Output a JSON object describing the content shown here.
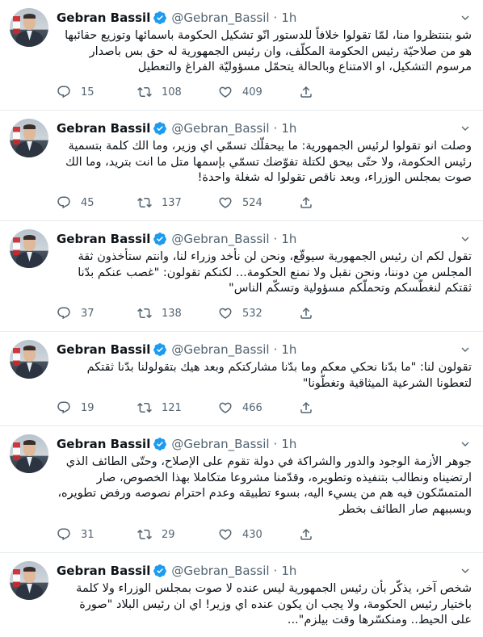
{
  "profile": {
    "name": "Gebran Bassil",
    "handle": "@Gebran_Bassil",
    "separator": "·",
    "time": "1h"
  },
  "tweets": [
    {
      "text": "شو بتنتظروا منا، لمّا تقولوا خلافاً للدستور انّو تشكيل الحكومة باسمائها وتوزيع حقائبها هو من صلاحيّة رئيس الحكومة المكلّف، وان رئيس الجمهورية له حق بس باصدار مرسوم التشكيل، او الامتناع وبالحالة يتحمّل مسؤوليّة الفراغ والتعطيل",
      "replies": "15",
      "retweets": "108",
      "likes": "409"
    },
    {
      "text": "وصلت انو تقولوا لرئيس الجمهورية: ما بيحقلّك تسمّي اي وزير، وما الك كلمة بتسمية رئيس الحكومة، ولا حتّى  بيحق لكتلة تفوّضك تسمّي بإسمها متل ما انت بتريد، وما الك صوت بمجلس الوزراء، وبعد ناقص تقولوا له شغلة واحدة!",
      "replies": "45",
      "retweets": "137",
      "likes": "524"
    },
    {
      "text": "تقول لكم ان رئيس الجمهورية سيوقّع، ونحن لن نأخد وزراء لنا، وانتم ستأخذون ثقة المجلس من دوننا، ونحن نقبل ولا  نمنع الحكومة... لكنكم تقولون: \"غصب عنكم بدّنا ثقتكم لنغطّسكم وتحملّكم مسؤولية وتسكّم الناس\"",
      "replies": "37",
      "retweets": "138",
      "likes": "532"
    },
    {
      "text": "تقولون لنا: \"ما بدّنا نحكي معكم وما بدّنا مشاركتكم وبعد هيك بتقولولنا بدّنا ثقتكم لتعطونا الشرعية الميثاقية وتغطّونا\"",
      "replies": "19",
      "retweets": "121",
      "likes": "466"
    },
    {
      "text": "جوهر الأزمة الوجود والدور والشراكة في دولة تقوم على الإصلاح، وحتّى الطائف الذي ارتضيناه ونطالب بتنفيذه وتطويره، وقدّمنا مشروعا متكاملا بهذا الخصوص، صار المتمسّكون فيه هم من يسيء اليه، بسوء تطبيقه وعدم احترام نصوصه ورفض تطويره، وبسببهم صار الطائف بخطر",
      "replies": "31",
      "retweets": "29",
      "likes": "430"
    },
    {
      "text": "شخص آخر، يذكّر بأن رئيس الجمهورية ليس عنده لا صوت بمجلس الوزراء ولا كلمة باختيار رئيس الحكومة، ولا يجب ان يكون عنده اي وزير! اي ان رئيس البلاد \"صورة على الحيط.. ومنكسّرها وقت بيلزم\"...",
      "replies": "",
      "retweets": "",
      "likes": ""
    }
  ],
  "icons": {
    "verified": "verified-badge-icon",
    "more": "chevron-down-icon",
    "reply": "reply-icon",
    "retweet": "retweet-icon",
    "like": "heart-icon",
    "share": "share-icon"
  },
  "colors": {
    "verified": "#1d9bf0",
    "text": "#0f1419",
    "secondary": "#536471",
    "divider": "#e6ecf0"
  }
}
